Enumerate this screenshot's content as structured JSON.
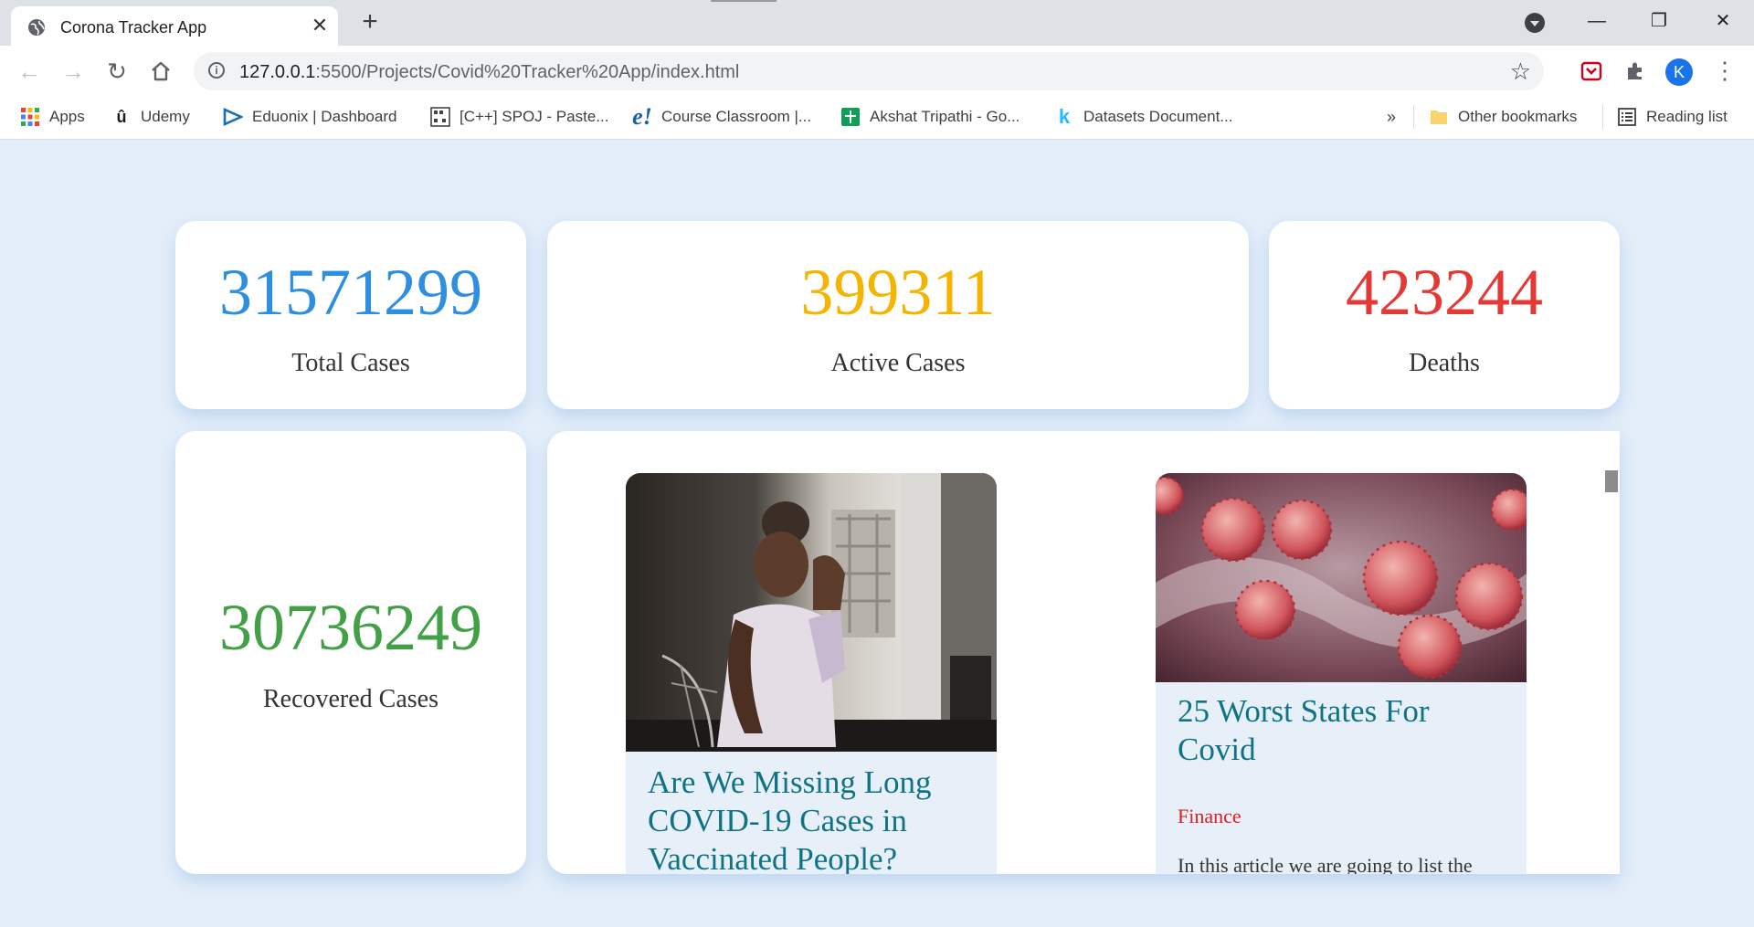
{
  "browser": {
    "tab_title": "Corona Tracker App",
    "new_tab_symbol": "+",
    "tab_close_symbol": "✕",
    "url_host": "127.0.0.1",
    "url_rest": ":5500/Projects/Covid%20Tracker%20App/index.html",
    "profile_initial": "K",
    "window_controls": {
      "minimize": "—",
      "restore": "❐",
      "close": "✕"
    },
    "bookmarks": [
      {
        "label": "Apps",
        "icon": "apps-grid-icon"
      },
      {
        "label": "Udemy",
        "icon": "udemy-icon"
      },
      {
        "label": "Eduonix | Dashboard",
        "icon": "eduonix-icon"
      },
      {
        "label": "[C++] SPOJ - Paste...",
        "icon": "spoj-icon"
      },
      {
        "label": "Course Classroom |...",
        "icon": "classroom-icon"
      },
      {
        "label": "Akshat Tripathi - Go...",
        "icon": "sheets-icon"
      },
      {
        "label": "Datasets Document...",
        "icon": "kaggle-icon"
      }
    ],
    "overflow_chevron": "»",
    "other_bookmarks": "Other bookmarks",
    "reading_list": "Reading list"
  },
  "stats": {
    "total": {
      "value": "31571299",
      "label": "Total Cases",
      "color": "#2e8fe0"
    },
    "active": {
      "value": "399311",
      "label": "Active Cases",
      "color": "#f4b400"
    },
    "deaths": {
      "value": "423244",
      "label": "Deaths",
      "color": "#e53935"
    },
    "recovered": {
      "value": "30736249",
      "label": "Recovered Cases",
      "color": "#43a047"
    }
  },
  "news": [
    {
      "title": "Are We Missing Long COVID-19 Cases in Vaccinated People?",
      "image": "woman-holding-head-photo"
    },
    {
      "title": "25 Worst States For Covid",
      "category": "Finance",
      "description": "In this article we are going to list the",
      "image": "coronavirus-particles-photo"
    }
  ],
  "colors": {
    "page_bg": "#e4eef9",
    "news_title": "#0f7385",
    "news_category": "#e21a1a"
  }
}
